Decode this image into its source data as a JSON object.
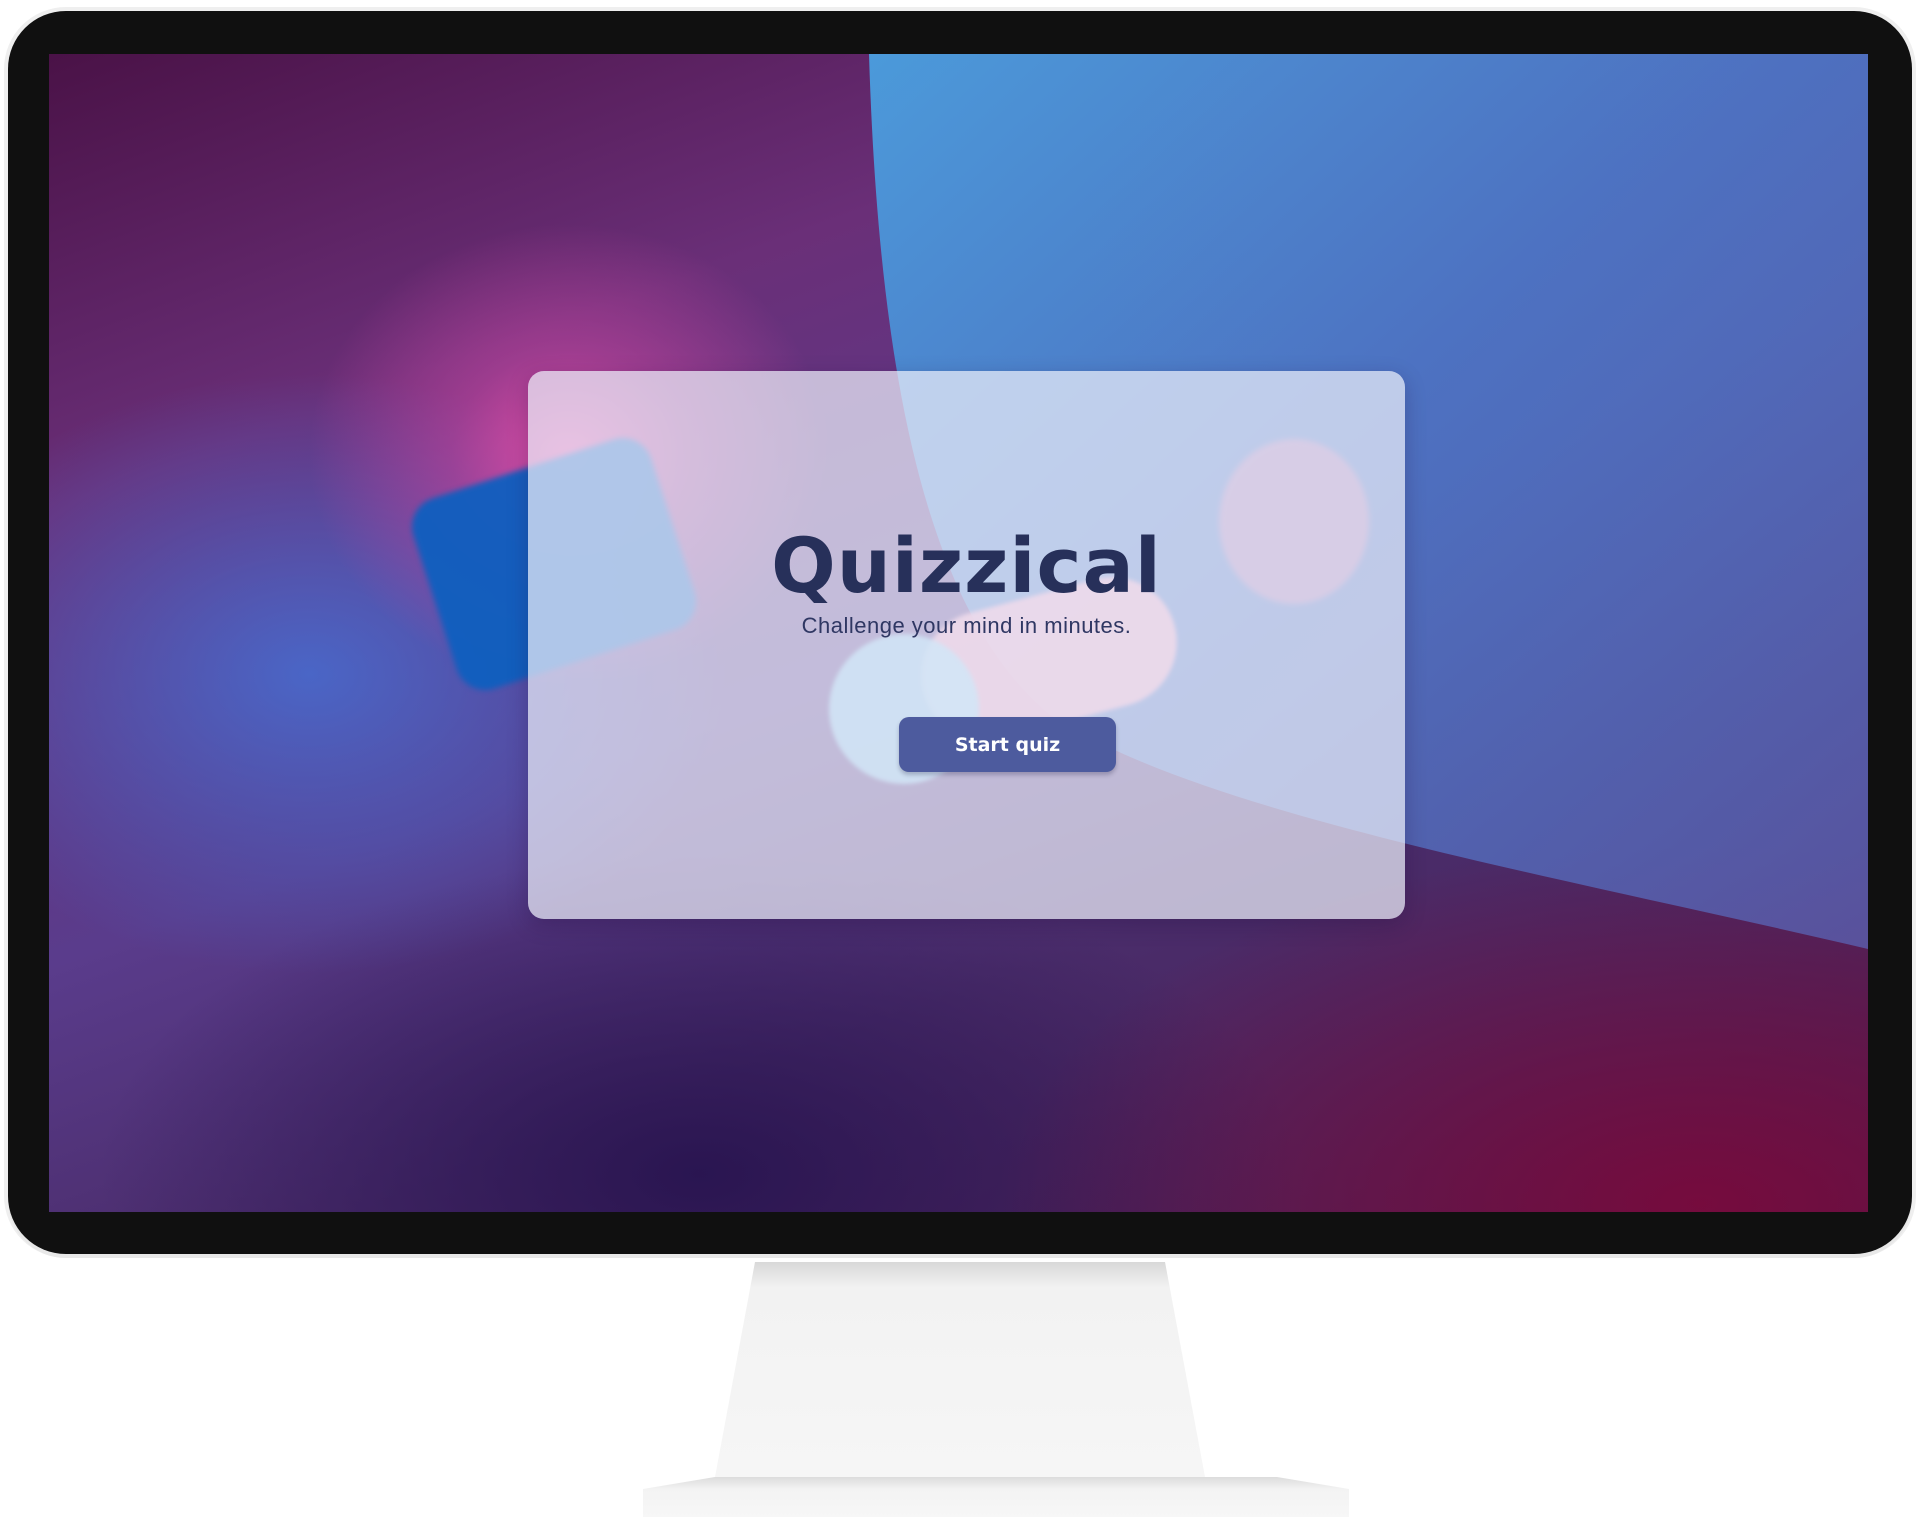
{
  "app": {
    "title": "Quizzical",
    "subtitle": "Challenge your mind in minutes.",
    "start_button_label": "Start quiz"
  },
  "colors": {
    "title_text": "#27305a",
    "button_background": "#4d5b9e",
    "button_text": "#ffffff",
    "card_background": "rgba(236,238,250,0.72)",
    "monitor_bezel": "#101010"
  }
}
